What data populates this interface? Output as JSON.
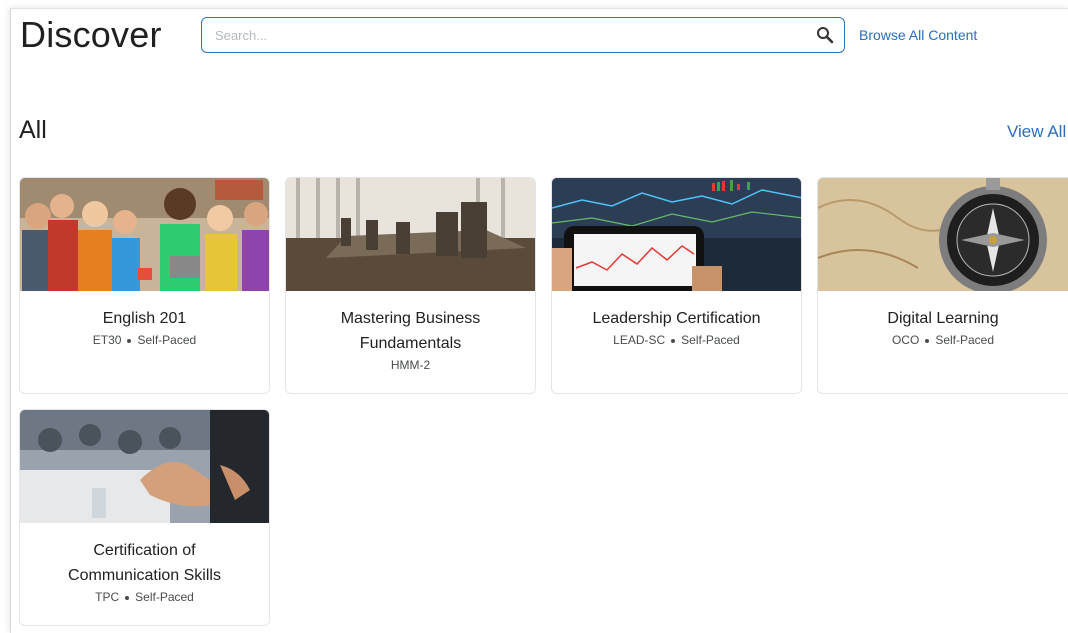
{
  "header": {
    "title": "Discover",
    "search_placeholder": "Search...",
    "browse_label": "Browse All Content"
  },
  "section": {
    "title": "All",
    "view_all_label": "View All"
  },
  "courses": [
    {
      "name": "English 201",
      "code": "ET30",
      "pace": "Self-Paced",
      "image": "students-with-devices"
    },
    {
      "name": "Mastering Business Fundamentals",
      "code": "HMM-2",
      "pace": "",
      "image": "empty-boardroom"
    },
    {
      "name": "Leadership Certification",
      "code": "LEAD-SC",
      "pace": "Self-Paced",
      "image": "tablet-stock-charts"
    },
    {
      "name": "Digital Learning",
      "code": "OCO",
      "pace": "Self-Paced",
      "image": "compass-on-map"
    },
    {
      "name": "Certification of Communication Skills",
      "code": "TPC",
      "pace": "Self-Paced",
      "image": "speaker-gesturing-hands"
    }
  ]
}
